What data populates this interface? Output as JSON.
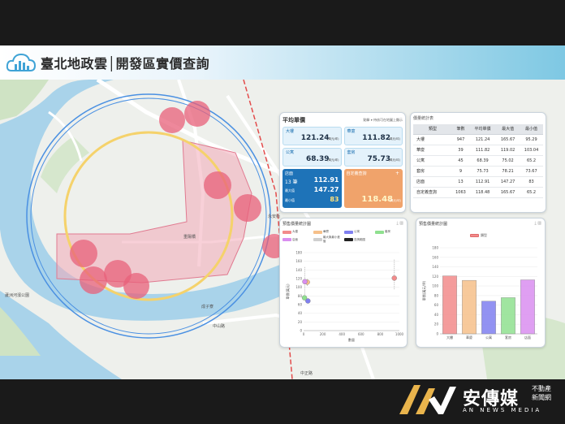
{
  "header": {
    "title": "臺北地政雲│開發區實價查詢"
  },
  "avg_panel": {
    "title": "平均單價",
    "subtitle": "點擊 ▾ 待核可在地圖上顯示",
    "cards": [
      {
        "label": "大樓",
        "value": "121.24",
        "unit": "(萬元/坪)"
      },
      {
        "label": "華廈",
        "value": "111.82",
        "unit": "(萬元/坪)"
      },
      {
        "label": "公寓",
        "value": "68.39",
        "unit": "(萬元/坪)"
      },
      {
        "label": "套房",
        "value": "75.73",
        "unit": "(萬元/坪)"
      }
    ],
    "store": {
      "label": "店面",
      "count": "13 筆",
      "avg": "112.91",
      "max_label": "最大值",
      "max": "147.27",
      "min_label": "最小值",
      "min": "83",
      "unit": "(萬元/坪)"
    },
    "custom": {
      "label": "自定義查詢",
      "plus": "+",
      "value": "118.48",
      "unit": "(萬元/坪)"
    }
  },
  "stats_panel": {
    "title": "價量統計表",
    "headers": [
      "類型",
      "筆數",
      "平均單價",
      "最大值",
      "最小值"
    ],
    "rows": [
      [
        "大樓",
        "947",
        "121.24",
        "165.67",
        "95.29"
      ],
      [
        "華廈",
        "39",
        "111.82",
        "119.02",
        "103.04"
      ],
      [
        "公寓",
        "45",
        "68.39",
        "75.02",
        "65.2"
      ],
      [
        "套房",
        "9",
        "75.73",
        "78.21",
        "73.67"
      ],
      [
        "店面",
        "13",
        "112.91",
        "147.27",
        "83"
      ],
      [
        "自定義查詢",
        "1063",
        "118.48",
        "165.67",
        "65.2"
      ]
    ]
  },
  "scatter_panel": {
    "title": "預售價量統計圖",
    "legend": [
      {
        "label": "大樓",
        "color": "#f28b8b"
      },
      {
        "label": "華廈",
        "color": "#f6c08a"
      },
      {
        "label": "公寓",
        "color": "#7f7ff0"
      },
      {
        "label": "套房",
        "color": "#8fe08f"
      },
      {
        "label": "店面",
        "color": "#d98ef0"
      },
      {
        "label": "最大與最小差值",
        "color": "#cfcfcf"
      },
      {
        "label": "查詢範圍",
        "color": "#222222"
      }
    ],
    "icons": [
      "download-icon",
      "bar-chart-icon"
    ]
  },
  "bar_panel": {
    "title": "預售價量統計圖",
    "legend": "類型",
    "icons": [
      "download-icon",
      "bar-chart-icon"
    ]
  },
  "map": {
    "labels": [
      "重陽橋",
      "蘆洲河濱公園",
      "中正路",
      "永安街",
      "成子寮",
      "中山路",
      "中正路"
    ]
  },
  "brand": {
    "name": "安傳媒",
    "tag_line1": "不動產",
    "tag_line2": "新聞網",
    "english": "AN NEWS MEDIA"
  },
  "chart_data": [
    {
      "type": "scatter",
      "xlabel": "數量",
      "ylabel": "單價(萬元)",
      "xlim": [
        0,
        1000
      ],
      "ylim": [
        0,
        180
      ],
      "xticks": [
        0,
        200,
        400,
        600,
        800,
        1000
      ],
      "yticks": [
        0,
        20,
        40,
        60,
        80,
        100,
        120,
        140,
        160,
        180
      ],
      "series": [
        {
          "name": "大樓",
          "color": "#f28b8b",
          "points": [
            [
              947,
              121.24
            ]
          ],
          "range": [
            95.29,
            165.67
          ]
        },
        {
          "name": "華廈",
          "color": "#f6c08a",
          "points": [
            [
              39,
              111.82
            ]
          ],
          "range": [
            103.04,
            119.02
          ]
        },
        {
          "name": "公寓",
          "color": "#7f7ff0",
          "points": [
            [
              45,
              68.39
            ]
          ],
          "range": [
            65.2,
            75.02
          ]
        },
        {
          "name": "套房",
          "color": "#8fe08f",
          "points": [
            [
              9,
              75.73
            ]
          ],
          "range": [
            73.67,
            78.21
          ]
        },
        {
          "name": "店面",
          "color": "#d98ef0",
          "points": [
            [
              13,
              112.91
            ]
          ],
          "range": [
            83,
            147.27
          ]
        }
      ]
    },
    {
      "type": "bar",
      "ylabel": "單價(萬元/坪)",
      "ylim": [
        0,
        180
      ],
      "yticks": [
        0,
        20,
        40,
        60,
        80,
        100,
        120,
        140,
        160,
        180
      ],
      "categories": [
        "大樓",
        "華廈",
        "公寓",
        "套房",
        "店面"
      ],
      "values": [
        121.24,
        111.82,
        68.39,
        75.73,
        112.91
      ],
      "colors": [
        "#f28b8b",
        "#f6c08a",
        "#7f7ff0",
        "#8fe08f",
        "#d98ef0"
      ]
    }
  ]
}
